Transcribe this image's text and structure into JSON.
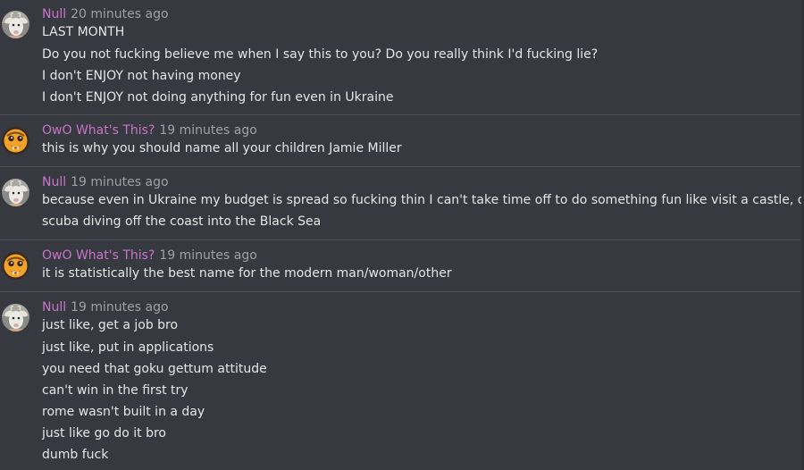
{
  "colors": {
    "background": "#36393f",
    "username": "#c874c8",
    "timestamp": "#9fa1a5",
    "message_text": "#e6e6e6",
    "divider": "#4b4e54"
  },
  "messages": [
    {
      "avatar_icon": "goat-avatar-icon",
      "username": "Null",
      "timestamp": "20 minutes ago",
      "lines": [
        "LAST MONTH",
        "Do you not fucking believe me when I say this to you? Do you really think I'd fucking lie?",
        "I don't ENJOY not having money",
        "I don't ENJOY not doing anything for fun even in Ukraine"
      ]
    },
    {
      "avatar_icon": "emoji-face-avatar-icon",
      "username": "OwO What's This?",
      "timestamp": "19 minutes ago",
      "lines": [
        "this is why you should name all your children Jamie Miller"
      ]
    },
    {
      "avatar_icon": "goat-avatar-icon",
      "username": "Null",
      "timestamp": "19 minutes ago",
      "lines": [
        "because even in Ukraine my budget is spread so fucking thin I can't take time off to do something fun like visit a castle, or go",
        "scuba diving off the coast into the Black Sea"
      ]
    },
    {
      "avatar_icon": "emoji-face-avatar-icon",
      "username": "OwO What's This?",
      "timestamp": "19 minutes ago",
      "lines": [
        "it is statistically the best name for the modern man/woman/other"
      ]
    },
    {
      "avatar_icon": "goat-avatar-icon",
      "username": "Null",
      "timestamp": "19 minutes ago",
      "lines": [
        "just like, get a job bro",
        "just like, put in applications",
        "you need that goku gettum attitude",
        "can't win in the first try",
        "rome wasn't built in a day",
        "just like go do it bro",
        "dumb fuck"
      ]
    }
  ]
}
